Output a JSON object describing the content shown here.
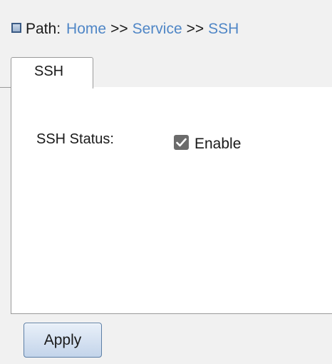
{
  "breadcrumb": {
    "label": "Path:",
    "items": [
      "Home",
      "Service",
      "SSH"
    ],
    "separator": ">>",
    "link_color": "#4f86c6"
  },
  "tabs": [
    {
      "label": "SSH",
      "active": true
    }
  ],
  "form": {
    "ssh_status": {
      "label": "SSH Status:",
      "checkbox_label": "Enable",
      "checked": true
    }
  },
  "actions": {
    "apply_label": "Apply"
  }
}
